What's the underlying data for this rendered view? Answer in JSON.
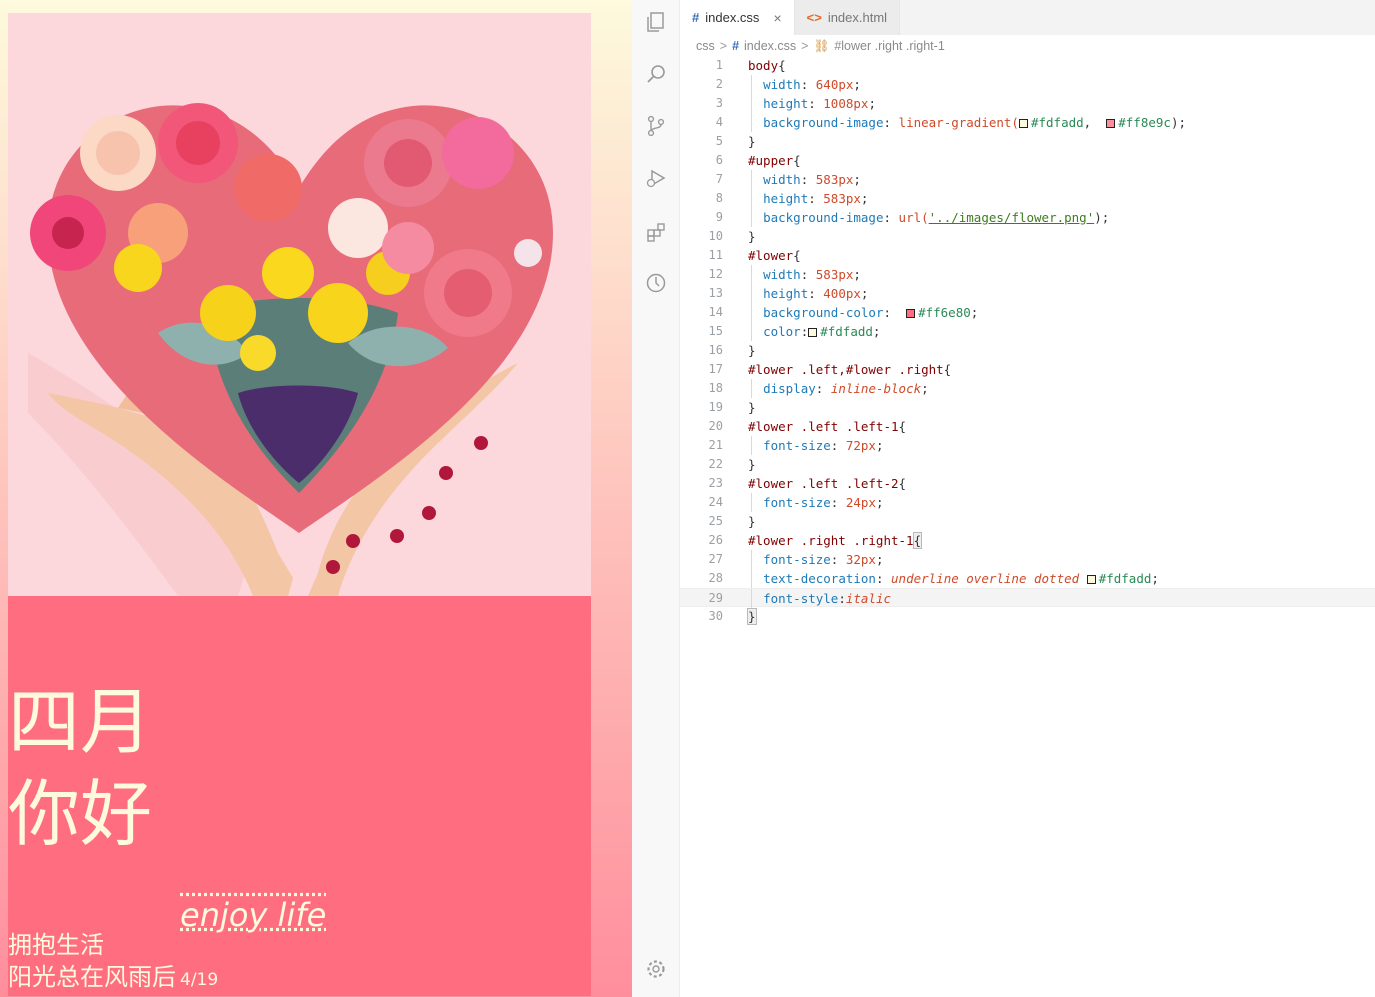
{
  "preview": {
    "heading_line1": "四月",
    "heading_line2": "你好",
    "enjoy": "enjoy life",
    "slogan_line1": "拥抱生活",
    "slogan_line2": "阳光总在风雨后",
    "page_indicator": "4/19",
    "colors": {
      "gradient_top": "#fdfadd",
      "gradient_bottom": "#ff8e9c",
      "lower_bg": "#ff6e80",
      "lower_text": "#fdfadd"
    }
  },
  "activity_bar": {
    "items": [
      "explorer-icon",
      "search-icon",
      "source-control-icon",
      "run-debug-icon",
      "extensions-icon",
      "timeline-icon"
    ],
    "bottom": "settings-gear-icon"
  },
  "tabs": [
    {
      "icon": "#",
      "label": "index.css",
      "close": "×"
    },
    {
      "icon": "<>",
      "label": "index.html"
    }
  ],
  "breadcrumb": {
    "folder": "css",
    "sep": ">",
    "file_icon": "#",
    "file": "index.css",
    "symbol_icon": "⛓",
    "symbol": "#lower .right .right-1"
  },
  "code": {
    "l1": "1",
    "l2": "2",
    "l3": "3",
    "l4": "4",
    "l5": "5",
    "l6": "6",
    "l7": "7",
    "l8": "8",
    "l9": "9",
    "l10": "10",
    "l11": "11",
    "l12": "12",
    "l13": "13",
    "l14": "14",
    "l15": "15",
    "l16": "16",
    "l17": "17",
    "l18": "18",
    "l19": "19",
    "l20": "20",
    "l21": "21",
    "l22": "22",
    "l23": "23",
    "l24": "24",
    "l25": "25",
    "l26": "26",
    "l27": "27",
    "l28": "28",
    "l29": "29",
    "l30": "30",
    "body_sel": "body",
    "upper_sel": "#upper",
    "lower_sel": "#lower",
    "lr_sel": "#lower .left,#lower .right",
    "left1_sel": "#lower .left .left-1",
    "left2_sel": "#lower .left .left-2",
    "right1_sel": "#lower .right .right-1",
    "open": "{",
    "close": "}",
    "p_width": "width",
    "p_height": "height",
    "p_bgimg": "background-image",
    "p_bgcolor": "background-color",
    "p_color": "color",
    "p_display": "display",
    "p_fontsize": "font-size",
    "p_textdec": "text-decoration",
    "p_fontstyle": "font-style",
    "colon": ": ",
    "colon_nospace": ":",
    "semi": ";",
    "v_640": "640px",
    "v_1008": "1008px",
    "v_583": "583px",
    "v_400": "400px",
    "v_72": "72px",
    "v_24": "24px",
    "v_32": "32px",
    "v_lg": "linear-gradient(",
    "v_url": "url(",
    "v_urlstr": "'../images/flower.png'",
    "v_paren": ")",
    "v_comma": ", ",
    "v_inline": "inline-block",
    "v_textdec": "underline overline dotted",
    "v_italic": "italic",
    "hex_fdfadd": "#fdfadd",
    "hex_ff8e9c": "#ff8e9c",
    "hex_ff6e80": "#ff6e80"
  }
}
